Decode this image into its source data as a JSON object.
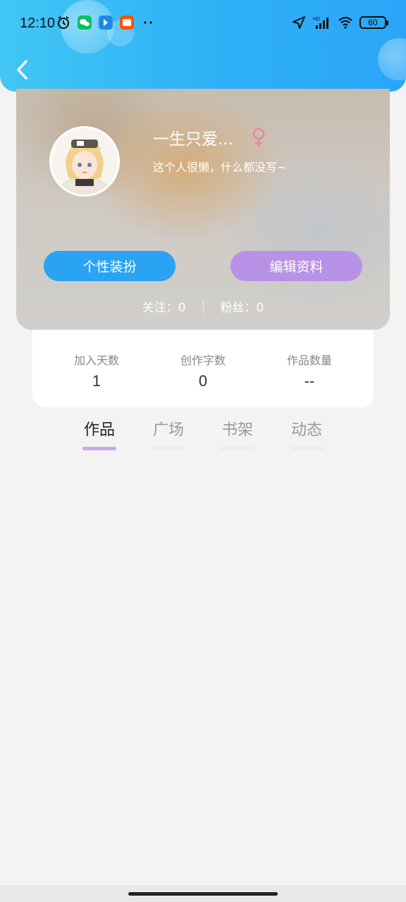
{
  "status_bar": {
    "time": "12:10",
    "battery": "60",
    "network_label": "HD"
  },
  "profile": {
    "nickname": "一生只爱...",
    "gender_icon": "female-icon",
    "bio": "这个人很懒，什么都没写~",
    "decor_button": "个性装扮",
    "edit_button": "编辑资料",
    "following": "关注：0",
    "followers": "粉丝：0"
  },
  "stats": [
    {
      "label": "加入天数",
      "value": "1"
    },
    {
      "label": "创作字数",
      "value": "0"
    },
    {
      "label": "作品数量",
      "value": "--"
    }
  ],
  "tabs": [
    {
      "label": "作品",
      "active": true
    },
    {
      "label": "广场",
      "active": false
    },
    {
      "label": "书架",
      "active": false
    },
    {
      "label": "动态",
      "active": false
    }
  ],
  "colors": {
    "header_gradient_start": "#42c6f5",
    "header_gradient_end": "#2aa6f8",
    "decor_button": "#2aa3f3",
    "edit_button": "#b892e6",
    "active_tab_underline": "#c8a8ea",
    "female_icon": "#e58aa6"
  }
}
